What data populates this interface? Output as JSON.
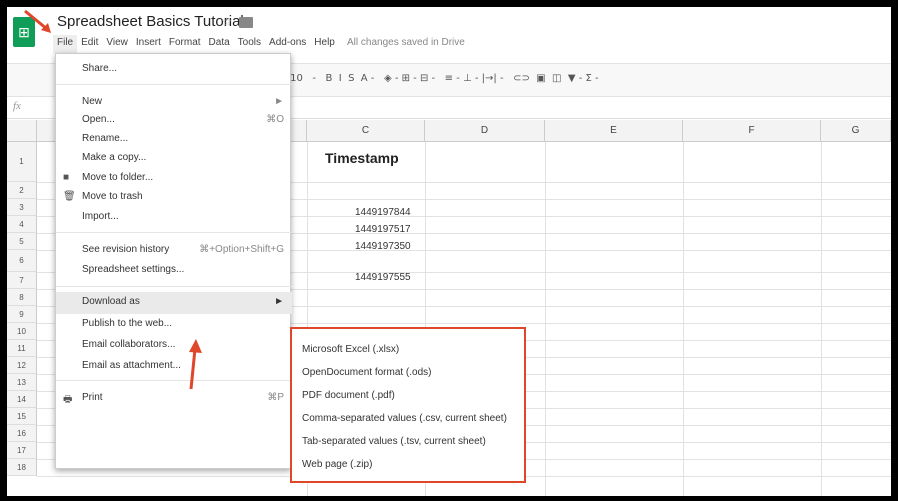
{
  "app": {
    "title": "Spreadsheet Basics Tutorial",
    "saved_status": "All changes saved in Drive"
  },
  "menubar": [
    "File",
    "Edit",
    "View",
    "Insert",
    "Format",
    "Data",
    "Tools",
    "Add-ons",
    "Help"
  ],
  "toolbar": {
    "text": "-   10   -   B  I  S  A -   ◈ - ⊞ - ⊟ -   ≡ - ⊥ - |→| -   ⊂⊃  ▣  ◫  ▼ - Σ -"
  },
  "formula_bar": {
    "label": "fx"
  },
  "columns": [
    "C",
    "D",
    "E",
    "F",
    "G"
  ],
  "rows": [
    "1",
    "2",
    "3",
    "4",
    "5",
    "6",
    "7",
    "8",
    "9",
    "10",
    "11",
    "12",
    "13",
    "14",
    "15",
    "16",
    "17",
    "18"
  ],
  "cells": {
    "header": "Timestamp",
    "values": [
      "1449197844",
      "1449197517",
      "1449197350",
      "1449197555"
    ]
  },
  "file_menu": {
    "items": [
      {
        "label": "Share...",
        "shortcut": "",
        "icon": ""
      },
      {
        "label": "New",
        "shortcut": "►",
        "icon": ""
      },
      {
        "label": "Open...",
        "shortcut": "⌘O",
        "icon": ""
      },
      {
        "label": "Rename...",
        "shortcut": "",
        "icon": ""
      },
      {
        "label": "Make a copy...",
        "shortcut": "",
        "icon": ""
      },
      {
        "label": "Move to folder...",
        "shortcut": "",
        "icon": "■"
      },
      {
        "label": "Move to trash",
        "shortcut": "",
        "icon": "🗑"
      },
      {
        "label": "Import...",
        "shortcut": "",
        "icon": ""
      },
      {
        "label": "See revision history",
        "shortcut": "⌘+Option+Shift+G",
        "icon": ""
      },
      {
        "label": "Spreadsheet settings...",
        "shortcut": "",
        "icon": ""
      },
      {
        "label": "Download as",
        "shortcut": "►",
        "icon": ""
      },
      {
        "label": "Publish to the web...",
        "shortcut": "",
        "icon": ""
      },
      {
        "label": "Email collaborators...",
        "shortcut": "",
        "icon": ""
      },
      {
        "label": "Email as attachment...",
        "shortcut": "",
        "icon": ""
      },
      {
        "label": "Print",
        "shortcut": "⌘P",
        "icon": "🖶"
      }
    ]
  },
  "download_submenu": [
    "Microsoft Excel (.xlsx)",
    "OpenDocument format (.ods)",
    "PDF document (.pdf)",
    "Comma-separated values (.csv, current sheet)",
    "Tab-separated values (.tsv, current sheet)",
    "Web page (.zip)"
  ],
  "colors": {
    "accent": "#0f9d58",
    "highlight_border": "#e0462a",
    "arrow": "#e0462a"
  }
}
